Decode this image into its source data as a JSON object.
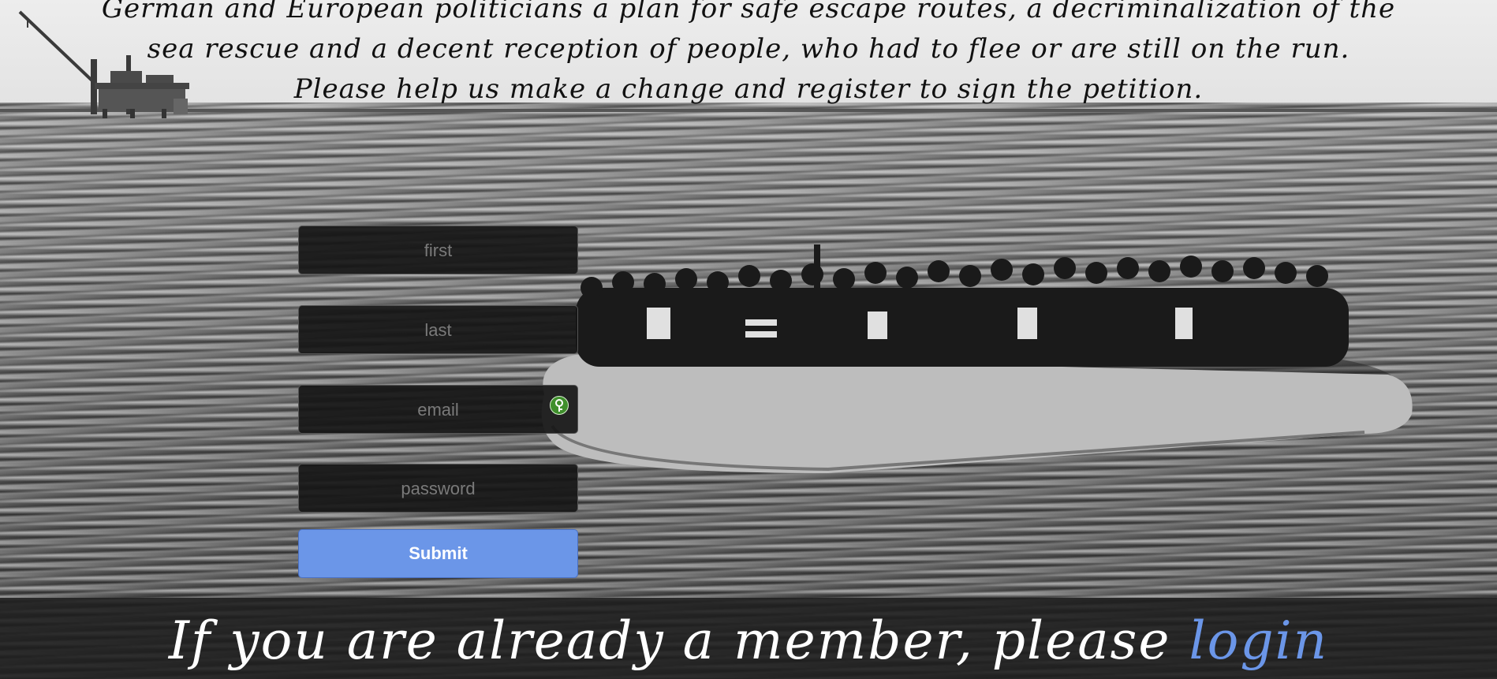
{
  "header": {
    "lines": [
      "German and European politicians a plan for safe escape routes, a decriminalization of the",
      "sea rescue and a decent reception of people, who had to flee or are still on the run.",
      "Please help us make a change and register to sign the petition."
    ]
  },
  "form": {
    "first_placeholder": "first",
    "last_placeholder": "last",
    "email_placeholder": "email",
    "password_placeholder": "password",
    "submit_label": "Submit"
  },
  "footer": {
    "text": "If you are already a member, please",
    "login_label": "login"
  },
  "colors": {
    "accent": "#6b96e8",
    "field_background": "#161616",
    "bottom_bar": "#1e1e1e"
  },
  "icons": {
    "password_manager": "password-manager-icon"
  }
}
